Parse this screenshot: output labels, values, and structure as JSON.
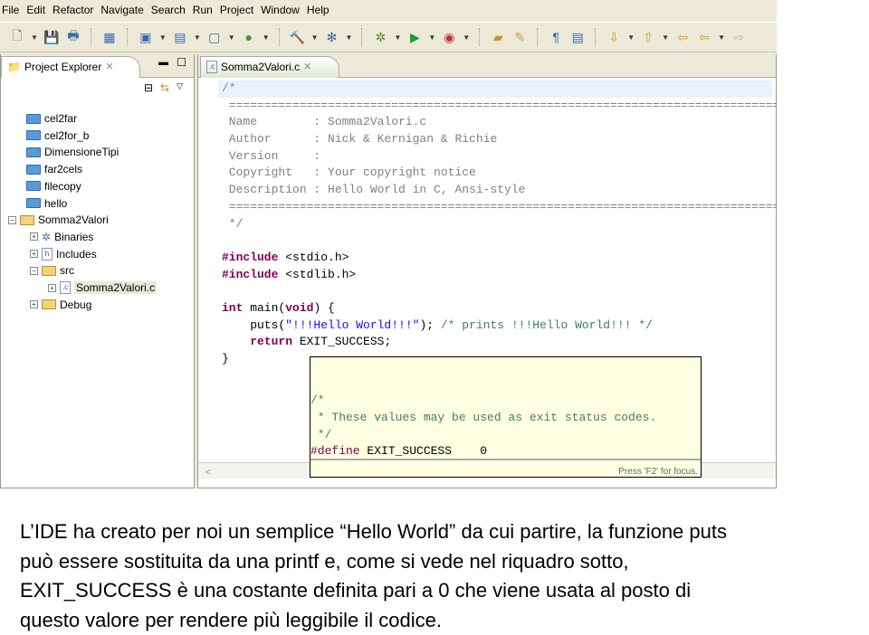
{
  "menu": [
    "File",
    "Edit",
    "Refactor",
    "Navigate",
    "Search",
    "Run",
    "Project",
    "Window",
    "Help"
  ],
  "toolbar_icons": [
    "new-icon",
    "save-icon",
    "print-icon",
    "binary-icon",
    "new-c-project-icon",
    "new-source-folder-icon",
    "new-c-file-icon",
    "new-class-icon",
    "build-icon",
    "build-settings-icon",
    "debug-icon",
    "run-icon",
    "external-tools-icon",
    "open-type-icon",
    "search-icon",
    "show-whitespace-icon",
    "toggle-block-icon",
    "next-annotation-icon",
    "previous-annotation-icon",
    "last-edit-icon",
    "back-icon",
    "forward-icon"
  ],
  "project_explorer": {
    "tab_label": "Project Explorer",
    "tree": [
      {
        "label": "cel2far",
        "type": "folder",
        "depth": 0
      },
      {
        "label": "cel2for_b",
        "type": "folder",
        "depth": 0
      },
      {
        "label": "DimensioneTipi",
        "type": "folder",
        "depth": 0
      },
      {
        "label": "far2cels",
        "type": "folder",
        "depth": 0
      },
      {
        "label": "filecopy",
        "type": "folder",
        "depth": 0
      },
      {
        "label": "hello",
        "type": "folder",
        "depth": 0
      },
      {
        "label": "Somma2Valori",
        "type": "project",
        "depth": 0,
        "expanded": true
      },
      {
        "label": "Binaries",
        "type": "binaries",
        "depth": 1
      },
      {
        "label": "Includes",
        "type": "includes",
        "depth": 1
      },
      {
        "label": "src",
        "type": "srcfolder",
        "depth": 1,
        "expanded": true
      },
      {
        "label": "Somma2Valori.c",
        "type": "cfile",
        "depth": 2,
        "selected": true
      },
      {
        "label": "Debug",
        "type": "folder-open",
        "depth": 1
      }
    ]
  },
  "editor": {
    "tab_label": "Somma2Valori.c",
    "lines": [
      "/*",
      " ========================================================================================",
      " Name        : Somma2Valori.c",
      " Author      : Nick & Kernigan & Richie",
      " Version     :",
      " Copyright   : Your copyright notice",
      " Description : Hello World in C, Ansi-style",
      " ========================================================================================",
      " */",
      "",
      "#include <stdio.h>",
      "#include <stdlib.h>",
      "",
      "int main(void) {",
      "    puts(\"!!!Hello World!!!\"); /* prints !!!Hello World!!! */",
      "    return EXIT_SUCCESS;",
      "}"
    ]
  },
  "hover": {
    "lines": [
      "/*",
      " * These values may be used as exit status codes.",
      " */",
      "#define EXIT_SUCCESS    0"
    ],
    "footer": "Press 'F2' for focus."
  },
  "caption": [
    "L’IDE ha creato per noi un semplice “Hello World” da cui partire, la funzione puts",
    "può essere sostituita da una printf  e, come si vede nel riquadro sotto,",
    "EXIT_SUCCESS  è una costante definita pari a 0 che viene usata al posto di",
    "questo valore per rendere più leggibile il codice."
  ]
}
